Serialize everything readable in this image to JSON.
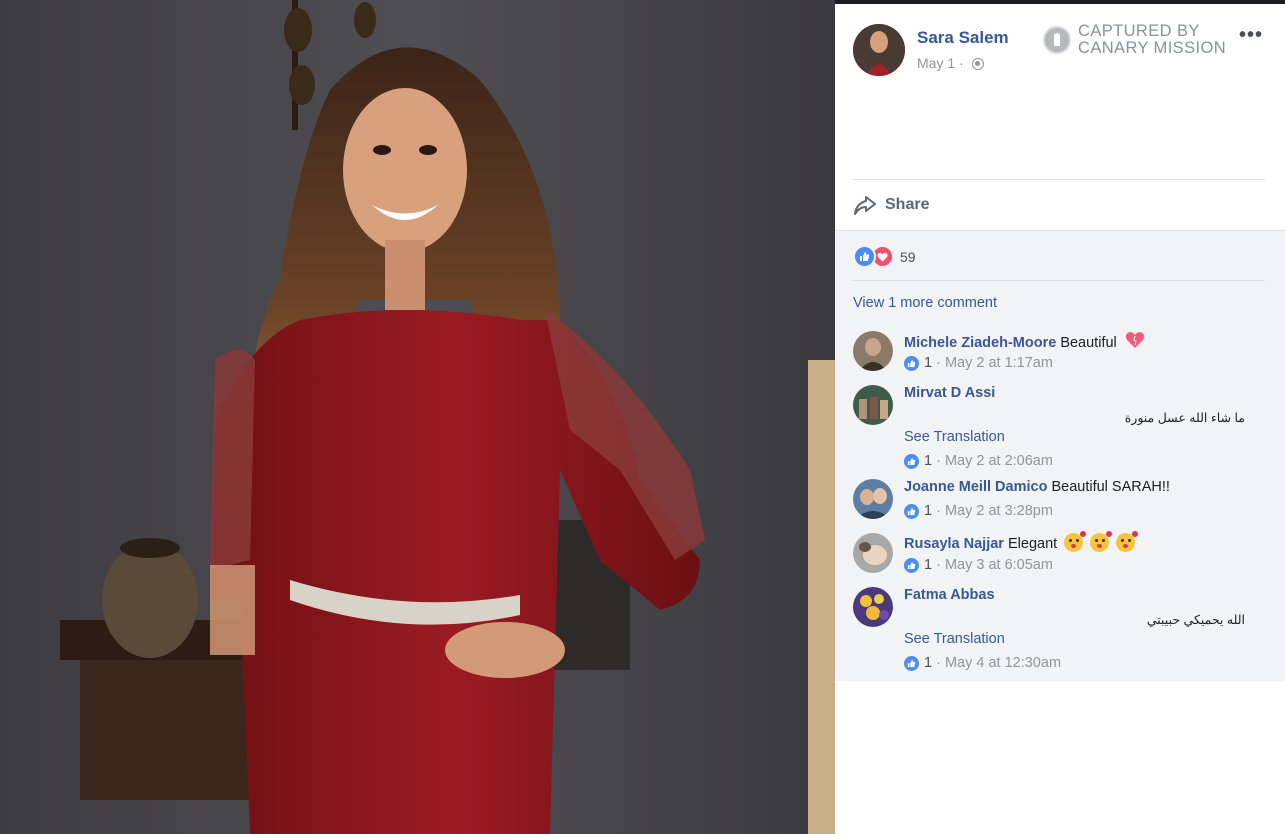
{
  "post": {
    "author": "Sara Salem",
    "date": "May 1",
    "dot": "·",
    "watermark_line1": "CAPTURED BY",
    "watermark_line2": "CANARY MISSION",
    "more_icon": "more-options-icon",
    "share_label": "Share",
    "reaction_count": "59",
    "view_more": "View 1 more comment"
  },
  "colors": {
    "link": "#385898",
    "author": "#365899",
    "meta": "#90949c",
    "like": "#4c8cf5",
    "love": "#f0506e",
    "comments_bg": "#f2f3f5"
  },
  "comments": [
    {
      "name": "Michele Ziadeh-Moore",
      "text": "Beautiful",
      "emoji": "heart-emoji",
      "likes": "1",
      "dot": "·",
      "time": "May 2 at 1:17am"
    },
    {
      "name": "Mirvat D Assi",
      "rtl_text": "ما شاء الله عسل منورة",
      "see_translation": "See Translation",
      "likes": "1",
      "dot": "·",
      "time": "May 2 at 2:06am"
    },
    {
      "name": "Joanne Meill Damico",
      "text": "Beautiful SARAH!!",
      "likes": "1",
      "dot": "·",
      "time": "May 2 at 3:28pm"
    },
    {
      "name": "Rusayla Najjar",
      "text": "Elegant",
      "emoji": "kiss-emoji",
      "likes": "1",
      "dot": "·",
      "time": "May 3 at 6:05am"
    },
    {
      "name": "Fatma Abbas",
      "rtl_text": "الله يحميكي حبيبتي",
      "see_translation": "See Translation",
      "likes": "1",
      "dot": "·",
      "time": "May 4 at 12:30am"
    }
  ]
}
